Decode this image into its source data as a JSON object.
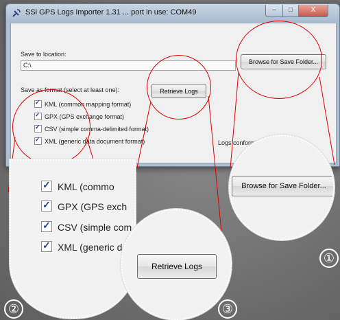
{
  "window": {
    "title": "SSi GPS Logs Importer 1.31 ... port in use: COM49",
    "controls": {
      "minimize": "–",
      "maximize": "□",
      "close": "X"
    }
  },
  "save_location": {
    "label": "Save to location:",
    "value": "C:\\",
    "browse_button": "Browse for Save Folder..."
  },
  "format": {
    "label": "Save as format (select at least one):",
    "retrieve_button": "Retrieve Logs",
    "options": [
      {
        "label": "KML (common mapping format)",
        "checked": true
      },
      {
        "label": "GPX (GPS exchange format)",
        "checked": true
      },
      {
        "label": "CSV (simple comma-delimited format)",
        "checked": true
      },
      {
        "label": "XML (generic data document format)",
        "checked": true
      }
    ],
    "status_text": "Logs conform"
  },
  "callouts": {
    "one": "①",
    "two": "②",
    "three": "③",
    "browse_zoom": "Browse for Save Folder...",
    "retrieve_zoom": "Retrieve Logs",
    "options_zoom": [
      "KML (commo",
      "GPX (GPS exch",
      "CSV (simple com",
      "XML (generic d"
    ]
  },
  "colors": {
    "highlight_circle": "#e00000",
    "check": "#1d3f8f"
  }
}
